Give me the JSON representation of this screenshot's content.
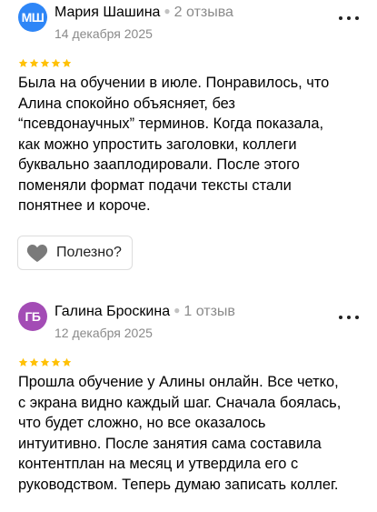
{
  "colors": {
    "star": "#ffc107",
    "avatar_1": "#2e86f7",
    "avatar_2": "#a34cb5",
    "muted": "#8a8a8a"
  },
  "reviews": [
    {
      "initials": "МШ",
      "author": "Мария Шашина",
      "review_count": "2 отзыва",
      "date": "14 декабря 2025",
      "rating": 5,
      "lines": [
        "Была на обучении в июле. Понравилось, что",
        "Алина спокойно объясняет, без",
        "“псевдонаучных” терминов. Когда показала,",
        "как можно упростить заголовки, коллеги",
        "буквально зааплодировали. После этого",
        "поменяли формат подачи тексты стали",
        "понятнее и короче."
      ],
      "helpful_label": "Полезно?",
      "helpful_icon": "heart-icon",
      "more_icon": "more-dots-icon"
    },
    {
      "initials": "ГБ",
      "author": "Галина Броскина",
      "review_count": "1 отзыв",
      "date": "12 декабря 2025",
      "rating": 5,
      "lines": [
        "Прошла обучение у Алины онлайн. Все четко,",
        "с экрана видно каждый шаг. Сначала боялась,",
        "что будет сложно, но все оказалось",
        "интуитивно. После занятия сама составила",
        "контентплан на месяц и утвердила его с",
        "руководством. Теперь думаю записать коллег."
      ],
      "more_icon": "more-dots-icon"
    }
  ]
}
